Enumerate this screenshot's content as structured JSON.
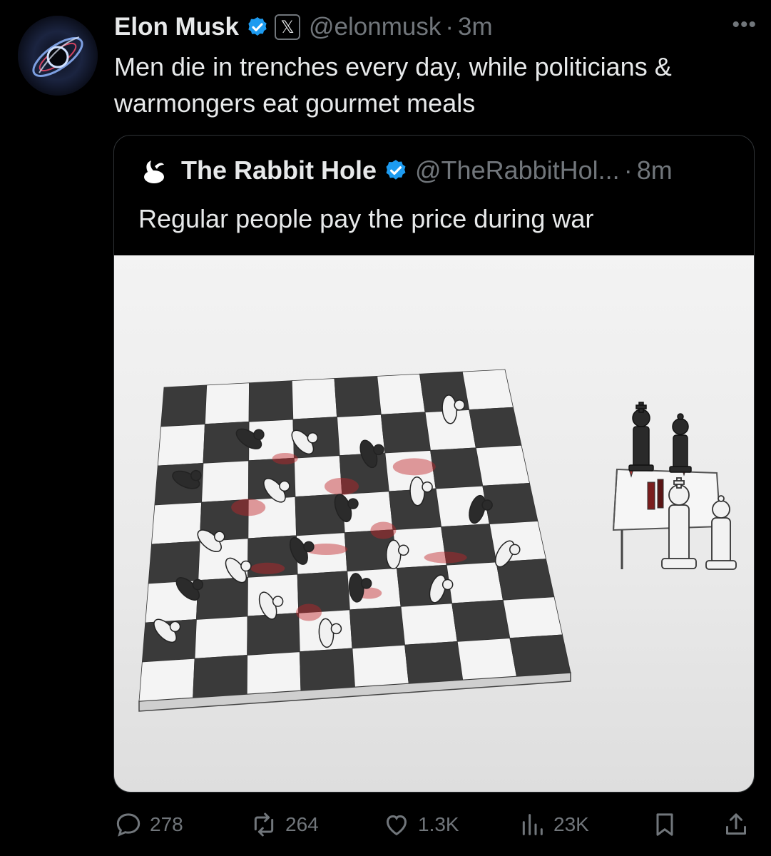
{
  "author": {
    "name": "Elon Musk",
    "handle": "@elonmusk",
    "time": "3m",
    "avatar_icon": "galaxy-avatar",
    "verified_color": "#1d9bf0"
  },
  "tweet": {
    "text": "Men die in trenches every day, while politicians & warmongers eat gourmet meals"
  },
  "quoted": {
    "name": "The Rabbit Hole",
    "handle": "@TheRabbitHol...",
    "time": "8m",
    "text": "Regular people pay the price during war",
    "logo_icon": "rabbit-icon",
    "image_description_icon": "chessboard-illustration"
  },
  "actions": {
    "replies": "278",
    "retweets": "264",
    "likes": "1.3K",
    "views": "23K"
  },
  "colors": {
    "background": "#000000",
    "text": "#e7e9ea",
    "muted": "#71767b",
    "accent": "#1d9bf0"
  }
}
